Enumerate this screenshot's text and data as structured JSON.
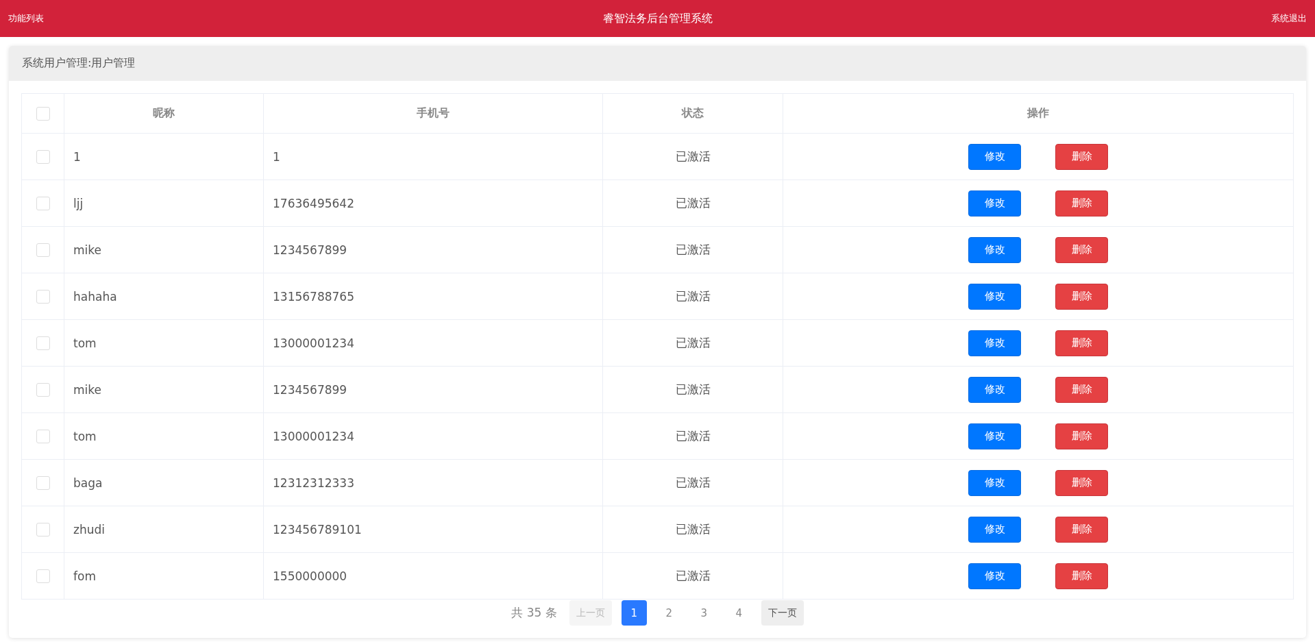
{
  "header": {
    "menu_label": "功能列表",
    "title": "睿智法务后台管理系统",
    "logout_label": "系统退出"
  },
  "panel": {
    "title": "系统用户管理:用户管理"
  },
  "table": {
    "select_all_checked": false,
    "columns": [
      "昵称",
      "手机号",
      "状态",
      "操作"
    ],
    "rows": [
      {
        "checked": false,
        "nickname": "1",
        "phone": "1",
        "status": "已激活",
        "edit": "修改",
        "delete": "删除"
      },
      {
        "checked": false,
        "nickname": "ljj",
        "phone": "17636495642",
        "status": "已激活",
        "edit": "修改",
        "delete": "删除"
      },
      {
        "checked": false,
        "nickname": "mike",
        "phone": "1234567899",
        "status": "已激活",
        "edit": "修改",
        "delete": "删除"
      },
      {
        "checked": false,
        "nickname": "hahaha",
        "phone": "13156788765",
        "status": "已激活",
        "edit": "修改",
        "delete": "删除"
      },
      {
        "checked": false,
        "nickname": "tom",
        "phone": "13000001234",
        "status": "已激活",
        "edit": "修改",
        "delete": "删除"
      },
      {
        "checked": false,
        "nickname": "mike",
        "phone": "1234567899",
        "status": "已激活",
        "edit": "修改",
        "delete": "删除"
      },
      {
        "checked": false,
        "nickname": "tom",
        "phone": "13000001234",
        "status": "已激活",
        "edit": "修改",
        "delete": "删除"
      },
      {
        "checked": false,
        "nickname": "baga",
        "phone": "12312312333",
        "status": "已激活",
        "edit": "修改",
        "delete": "删除"
      },
      {
        "checked": false,
        "nickname": "zhudi",
        "phone": "123456789101",
        "status": "已激活",
        "edit": "修改",
        "delete": "删除"
      },
      {
        "checked": false,
        "nickname": "fom",
        "phone": "1550000000",
        "status": "已激活",
        "edit": "修改",
        "delete": "删除"
      }
    ]
  },
  "pagination": {
    "total": "共 35 条",
    "prev": {
      "label": "上一页",
      "disabled": true
    },
    "pages": [
      {
        "label": "1",
        "selected": true
      },
      {
        "label": "2",
        "selected": false
      },
      {
        "label": "3",
        "selected": false
      },
      {
        "label": "4",
        "selected": false
      }
    ],
    "next": {
      "label": "下一页",
      "disabled": false
    }
  }
}
